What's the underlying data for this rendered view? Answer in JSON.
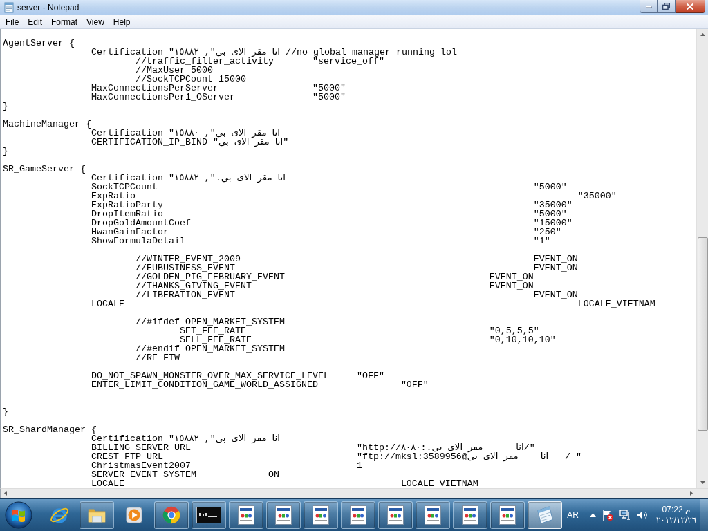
{
  "window": {
    "title": "server - Notepad"
  },
  "menu": [
    "File",
    "Edit",
    "Format",
    "View",
    "Help"
  ],
  "editor": {
    "lines": [
      {
        "kind": "code",
        "text": "AgentServer {"
      },
      {
        "kind": "code",
        "text": "\t\tCertification \"انا مقر الاى بى\", ١٥٨٨٢ //no global manager running lol"
      },
      {
        "kind": "code",
        "text": "\t\t\t//traffic_filter_activity\t\"service_off\""
      },
      {
        "kind": "code",
        "text": "\t\t\t//MaxUser 5000"
      },
      {
        "kind": "code",
        "text": "\t\t\t//SockTCPCount 15000"
      },
      {
        "kind": "code",
        "text": "\t\tMaxConnectionsPerServer\t\t\t\"5000\""
      },
      {
        "kind": "code",
        "text": "\t\tMaxConnectionsPer1_OServer\t\t\"5000\""
      },
      {
        "kind": "code",
        "text": "}"
      },
      {
        "kind": "blank"
      },
      {
        "kind": "code",
        "text": "MachineManager {"
      },
      {
        "kind": "code",
        "text": "\t\tCertification \"انا مقر الاى بى\", ١٥٨٨٠"
      },
      {
        "kind": "code",
        "text": "\t\tCERTIFICATION_IP_BIND \"انا مقر الاى بى\""
      },
      {
        "kind": "code",
        "text": "}"
      },
      {
        "kind": "blank"
      },
      {
        "kind": "code",
        "text": "SR_GameServer {"
      },
      {
        "kind": "code",
        "text": "\t\tCertification \"انا مقر الاى بى.\", ١٥٨٨٢"
      },
      {
        "kind": "code",
        "text": "\t\tSockTCPCount\t\t\t\t\t\t\t\t\t\"5000\""
      },
      {
        "kind": "code",
        "text": "\t\tExpRatio\t\t\t\t\t\t\t\t\t\t\"35000\""
      },
      {
        "kind": "code",
        "text": "\t\tExpRatioParty\t\t\t\t\t\t\t\t\t\"35000\""
      },
      {
        "kind": "code",
        "text": "\t\tDropItemRatio\t\t\t\t\t\t\t\t\t\"5000\""
      },
      {
        "kind": "code",
        "text": "\t\tDropGoldAmountCoef\t\t\t\t\t\t\t\t\"15000\""
      },
      {
        "kind": "code",
        "text": "\t\tHwanGainFactor\t\t\t\t\t\t\t\t\t\"250\""
      },
      {
        "kind": "code",
        "text": "\t\tShowFormulaDetail\t\t\t\t\t\t\t\t\"1\""
      },
      {
        "kind": "blank"
      },
      {
        "kind": "code",
        "text": "\t\t\t//WINTER_EVENT_2009\t\t\t\t\t\t\tEVENT_ON"
      },
      {
        "kind": "code",
        "text": "\t\t\t//EUBUSINESS_EVENT\t\t\t\t\t\t\tEVENT_ON"
      },
      {
        "kind": "code",
        "text": "\t\t\t//GOLDEN_PIG_FEBRUARY_EVENT\t\t\t\t\tEVENT_ON"
      },
      {
        "kind": "code",
        "text": "\t\t\t//THANKS_GIVING_EVENT\t\t\t\t\t\tEVENT_ON"
      },
      {
        "kind": "code",
        "text": "\t\t\t//LIBERATION_EVENT\t\t\t\t\t\t\tEVENT_ON"
      },
      {
        "kind": "code",
        "text": "\t\tLOCALE\t\t\t\t\t\t\t\t\t\t\tLOCALE_VIETNAM"
      },
      {
        "kind": "blank"
      },
      {
        "kind": "code",
        "text": "\t\t\t//#ifdef OPEN_MARKET_SYSTEM"
      },
      {
        "kind": "code",
        "text": "\t\t\t\tSET_FEE_RATE\t\t\t\t\t\t\"0,5,5,5\""
      },
      {
        "kind": "code",
        "text": "\t\t\t\tSELL_FEE_RATE\t\t\t\t\t\t\"0,10,10,10\""
      },
      {
        "kind": "code",
        "text": "\t\t\t//#endif OPEN_MARKET_SYSTEM"
      },
      {
        "kind": "code",
        "text": "\t\t\t//RE FTW"
      },
      {
        "kind": "blank"
      },
      {
        "kind": "code",
        "text": "\t\tDO_NOT_SPAWN_MONSTER_OVER_MAX_SERVICE_LEVEL\t\"OFF\""
      },
      {
        "kind": "code",
        "text": "\t\tENTER_LIMIT_CONDITION_GAME_WORLD_ASSIGNED\t\t\"OFF\""
      },
      {
        "kind": "blank"
      },
      {
        "kind": "blank"
      },
      {
        "kind": "code",
        "text": "}"
      },
      {
        "kind": "blank"
      },
      {
        "kind": "code",
        "text": "SR_ShardManager {"
      },
      {
        "kind": "code",
        "text": "\t\tCertification \"انا مقر الاى بى\", ١٥٨٨٢"
      },
      {
        "kind": "code",
        "text": "\t\tBILLING_SERVER_URL\t\t\t\t\"http://انا      مقر الاى بى.:٨٠٨٠/\""
      },
      {
        "kind": "code",
        "text": "\t\tCREST_FTP_URL\t\t\t\t\t\"ftp://mksl:3589956@انا    مقر الاى بى   / \""
      },
      {
        "kind": "code",
        "text": "\t\tChristmasEvent2007\t\t\t\t1"
      },
      {
        "kind": "code",
        "text": "\t\tSERVER_EVENT_SYSTEM\t\tON"
      },
      {
        "kind": "code",
        "text": "\t\tLOCALE\t\t\t\t\t\t\tLOCALE_VIETNAM"
      }
    ]
  },
  "taskbar": {
    "items": [
      {
        "kind": "browser-e",
        "open": false,
        "active": false
      },
      {
        "kind": "folder",
        "open": true,
        "active": false
      },
      {
        "kind": "player",
        "open": false,
        "active": false
      },
      {
        "kind": "browser-round",
        "open": true,
        "active": false
      },
      {
        "kind": "terminal",
        "open": true,
        "active": false
      },
      {
        "kind": "app-window",
        "open": true,
        "active": false
      },
      {
        "kind": "app-window",
        "open": true,
        "active": false
      },
      {
        "kind": "app-window",
        "open": true,
        "active": false
      },
      {
        "kind": "app-window",
        "open": true,
        "active": false
      },
      {
        "kind": "app-window",
        "open": true,
        "active": false
      },
      {
        "kind": "app-window",
        "open": true,
        "active": false
      },
      {
        "kind": "app-window",
        "open": true,
        "active": false
      },
      {
        "kind": "app-window",
        "open": true,
        "active": false
      },
      {
        "kind": "notepad",
        "open": true,
        "active": true
      }
    ],
    "tray": {
      "language": "AR",
      "time": "07:22 م",
      "date": "٢٠١٢/١٢/٢٦"
    }
  }
}
